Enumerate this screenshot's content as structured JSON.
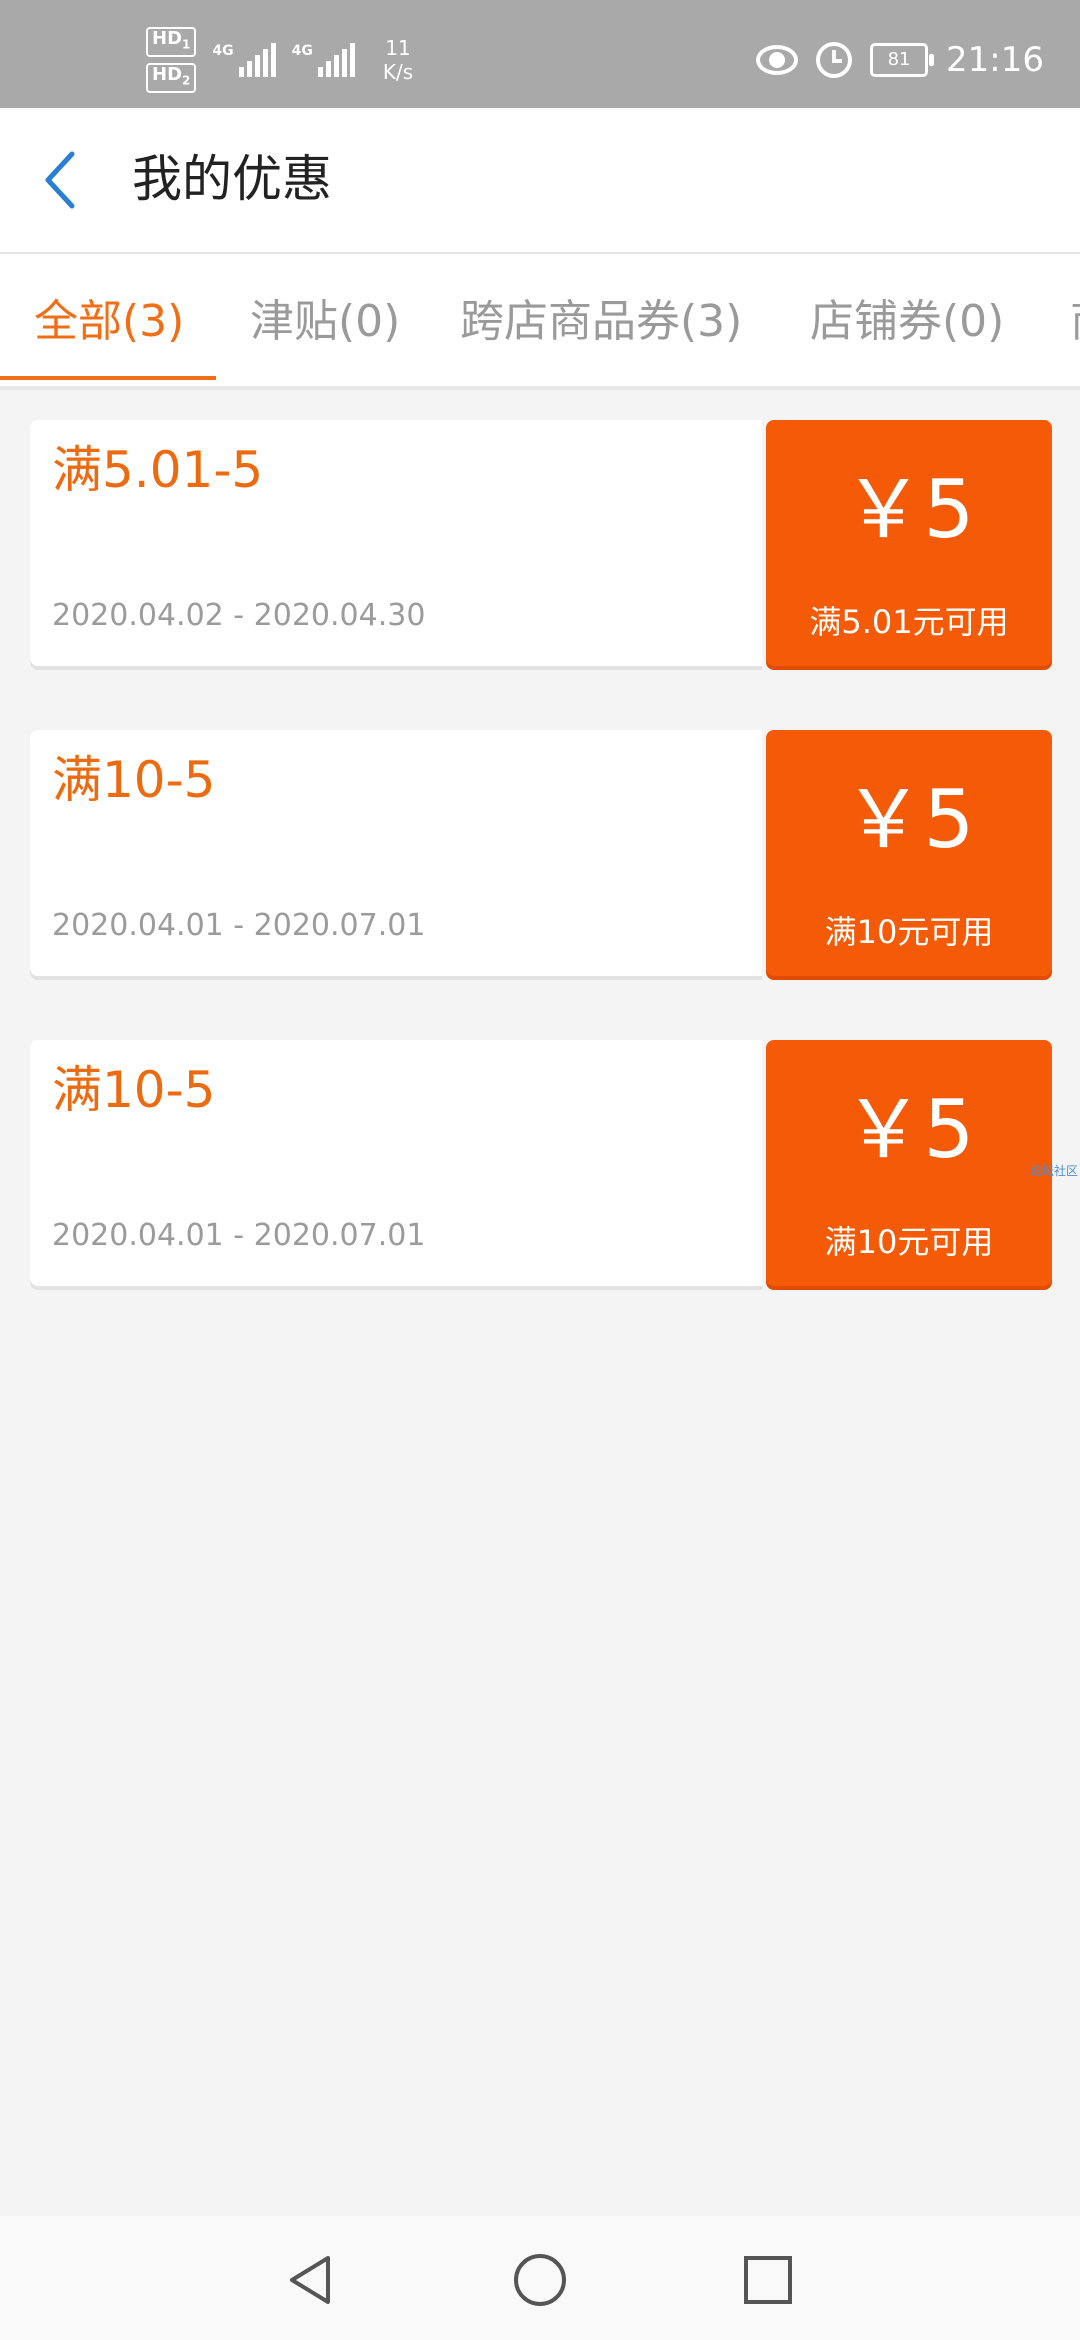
{
  "status_bar": {
    "sim1": "HD",
    "sim1_sub": "1",
    "sim2": "HD",
    "sim2_sub": "2",
    "net1": "4G",
    "net2": "4G",
    "speed_value": "11",
    "speed_unit": "K/s",
    "battery": "81",
    "time": "21:16",
    "icons": [
      "eye-comfort-icon",
      "alarm-icon",
      "battery-icon"
    ]
  },
  "header": {
    "title": "我的优惠",
    "back_icon": "chevron-left-icon"
  },
  "tabs": [
    {
      "label": "全部(3)",
      "active": true
    },
    {
      "label": "津贴(0)",
      "active": false
    },
    {
      "label": "跨店商品券(3)",
      "active": false
    },
    {
      "label": "店铺券(0)",
      "active": false
    },
    {
      "label": "商",
      "active": false
    }
  ],
  "coupons": [
    {
      "title": "满5.01-5",
      "date_range": "2020.04.02 - 2020.04.30",
      "amount": "￥5",
      "condition": "满5.01元可用"
    },
    {
      "title": "满10-5",
      "date_range": "2020.04.01 - 2020.07.01",
      "amount": "￥5",
      "condition": "满10元可用"
    },
    {
      "title": "满10-5",
      "date_range": "2020.04.01 - 2020.07.01",
      "amount": "￥5",
      "condition": "满10元可用"
    }
  ],
  "watermark": "论坛社区",
  "colors": {
    "accent": "#f06f16",
    "coupon_bg": "#f55a06",
    "back_icon": "#2a7fd4",
    "status_bar": "#a9a9a9"
  },
  "nav": [
    "back-triangle-icon",
    "home-circle-icon",
    "recents-square-icon"
  ]
}
